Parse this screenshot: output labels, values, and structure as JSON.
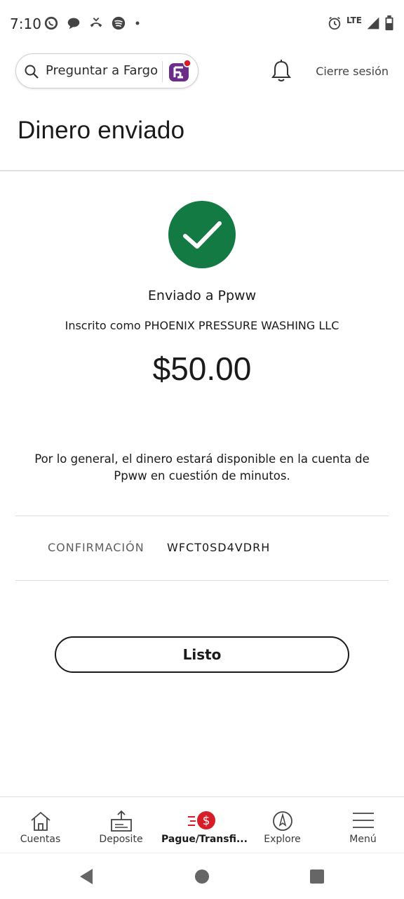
{
  "status_bar": {
    "time": "7:10",
    "network": "LTE",
    "left_icons": [
      "whatsapp-icon",
      "chat-bubble-icon",
      "missed-call-icon",
      "spotify-icon",
      "dot-icon"
    ],
    "right_icons": [
      "alarm-icon",
      "signal-icon",
      "battery-icon"
    ]
  },
  "header": {
    "search_label": "Preguntar a Fargo",
    "logout_label": "Cierre sesión"
  },
  "page": {
    "title": "Dinero enviado",
    "sent_to": "Enviado a Ppww",
    "enrolled_as": "Inscrito como PHOENIX PRESSURE WASHING LLC",
    "amount": "$50.00",
    "note": "Por lo general, el dinero estará disponible en la cuenta de Ppww en cuestión de minutos.",
    "confirmation_label": "CONFIRMACIÓN",
    "confirmation_value": "WFCT0SD4VDRH",
    "done_label": "Listo"
  },
  "colors": {
    "success_green": "#137a44",
    "brand_red": "#d71e28",
    "fargo_purple": "#6b2c8a"
  },
  "bottom_nav": {
    "items": [
      {
        "label": "Cuentas",
        "icon": "home-icon"
      },
      {
        "label": "Deposite",
        "icon": "deposit-icon"
      },
      {
        "label": "Pague/Transfi...",
        "icon": "pay-transfer-icon",
        "active": true
      },
      {
        "label": "Explore",
        "icon": "compass-icon"
      },
      {
        "label": "Menú",
        "icon": "hamburger-icon"
      }
    ]
  }
}
